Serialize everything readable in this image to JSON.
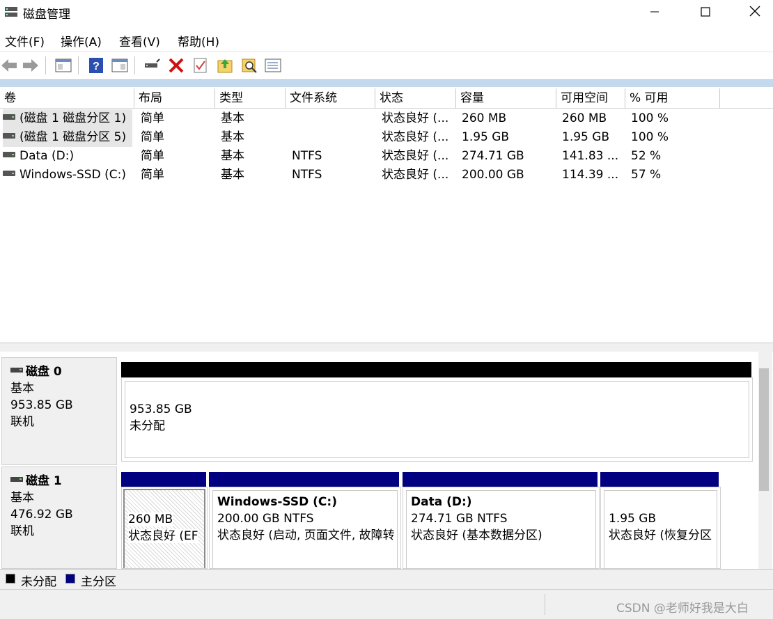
{
  "window": {
    "title": "磁盘管理",
    "minimize": "—",
    "maximize": "☐",
    "close": "✕"
  },
  "menu": [
    "文件(F)",
    "操作(A)",
    "查看(V)",
    "帮助(H)"
  ],
  "toolbar": {
    "icons": [
      "back-icon",
      "forward-icon",
      "properties-panel-icon",
      "help-icon",
      "show-hide-icon",
      "connect-disk-icon",
      "delete-icon",
      "check-icon",
      "export-icon",
      "search-icon",
      "list-view-icon"
    ]
  },
  "columns": [
    "卷",
    "布局",
    "类型",
    "文件系统",
    "状态",
    "容量",
    "可用空间",
    "% 可用"
  ],
  "volumes": [
    {
      "volume": "(磁盘 1 磁盘分区 1)",
      "layout": "简单",
      "type": "基本",
      "fs": "",
      "status": "状态良好 (...",
      "capacity": "260 MB",
      "free": "260 MB",
      "pct": "100 %"
    },
    {
      "volume": "(磁盘 1 磁盘分区 5)",
      "layout": "简单",
      "type": "基本",
      "fs": "",
      "status": "状态良好 (...",
      "capacity": "1.95 GB",
      "free": "1.95 GB",
      "pct": "100 %"
    },
    {
      "volume": "Data (D:)",
      "layout": "简单",
      "type": "基本",
      "fs": "NTFS",
      "status": "状态良好 (...",
      "capacity": "274.71 GB",
      "free": "141.83 ...",
      "pct": "52 %"
    },
    {
      "volume": "Windows-SSD (C:)",
      "layout": "简单",
      "type": "基本",
      "fs": "NTFS",
      "status": "状态良好 (...",
      "capacity": "200.00 GB",
      "free": "114.39 ...",
      "pct": "57 %"
    }
  ],
  "disks": [
    {
      "name": "磁盘 0",
      "type": "基本",
      "size": "953.85 GB",
      "status": "联机",
      "partitions": [
        {
          "title": "",
          "size": "953.85 GB",
          "status": "未分配"
        }
      ]
    },
    {
      "name": "磁盘 1",
      "type": "基本",
      "size": "476.92 GB",
      "status": "联机",
      "partitions": [
        {
          "title": "",
          "size": "260 MB",
          "status": "状态良好 (EF"
        },
        {
          "title": "Windows-SSD  (C:)",
          "size": "200.00 GB NTFS",
          "status": "状态良好 (启动, 页面文件, 故障转"
        },
        {
          "title": "Data  (D:)",
          "size": "274.71 GB NTFS",
          "status": "状态良好 (基本数据分区)"
        },
        {
          "title": "",
          "size": "1.95 GB",
          "status": "状态良好 (恢复分区"
        }
      ]
    }
  ],
  "legend": {
    "unallocated": "未分配",
    "primary": "主分区",
    "colors": {
      "unallocated": "#000000",
      "primary": "#000080"
    }
  },
  "watermark": "CSDN @老师好我是大白"
}
